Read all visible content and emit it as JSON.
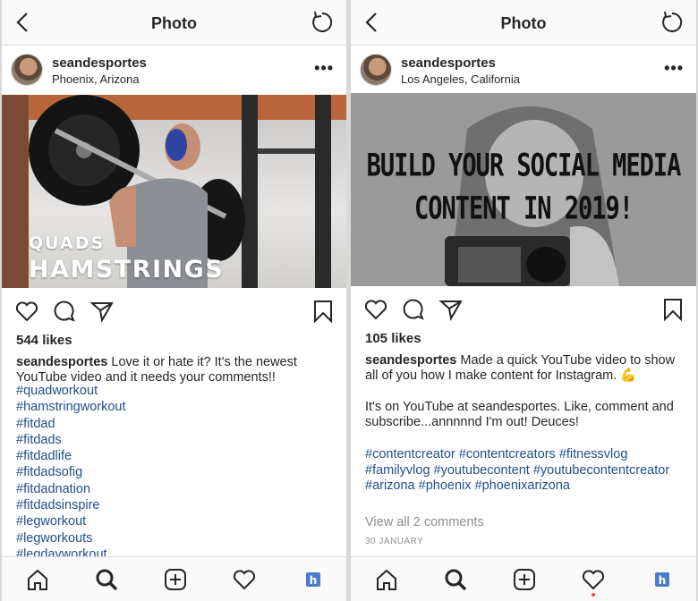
{
  "left": {
    "title": "Photo",
    "username": "seandesportes",
    "location": "Phoenix, Arizona",
    "more": "•••",
    "image_text_line1": "QUADS",
    "image_text_line2": "HAMSTRINGS",
    "likes": "544 likes",
    "caption_user": "seandesportes",
    "caption_text": " Love it or hate it? It's the newest YouTube video and it needs your comments!!",
    "tags": [
      "#quadworkout",
      "#hamstringworkout",
      "#fitdad",
      "#fitdads",
      "#fitdadlife",
      "#fitdadsofig",
      "#fitdadnation",
      "#fitdadsinspire",
      "#legworkout",
      "#legworkouts",
      "#legdayworkout"
    ]
  },
  "right": {
    "title": "Photo",
    "username": "seandesportes",
    "location": "Los Angeles, California",
    "more": "•••",
    "image_text_line1": "BUILD YOUR SOCIAL MEDIA",
    "image_text_line2": "CONTENT IN 2019!",
    "likes": "105 likes",
    "caption_user": "seandesportes",
    "caption_text": " Made a quick YouTube video to show all of you how I make content for Instagram. 💪",
    "caption_para2": "It's on YouTube at seandesportes. Like, comment and subscribe...annnnnd I'm out! Deuces!",
    "tags_text": "#contentcreator #contentcreators #fitnessvlog #familyvlog #youtubecontent #youtubecontentcreator #arizona #phoenix #phoenixarizona",
    "view_all": "View all 2 comments",
    "date": "30 JANUARY"
  },
  "icons": {
    "back": "chevron-left-icon",
    "refresh": "refresh-icon",
    "like": "heart-icon",
    "comment": "comment-icon",
    "share": "send-icon",
    "save": "bookmark-icon",
    "home": "home-icon",
    "search": "search-icon",
    "add": "add-post-icon",
    "activity": "heart-icon",
    "profile": "profile-icon"
  },
  "colors": {
    "hashtag": "#1f4f8b",
    "notification_dot": "#ed4956",
    "muted": "#8e8e8e"
  }
}
